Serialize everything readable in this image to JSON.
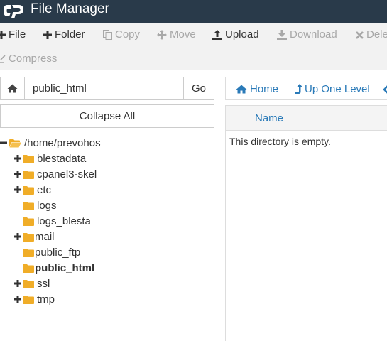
{
  "app": {
    "title": "File Manager",
    "logo_icon": "cpanel-logo"
  },
  "toolbar": {
    "items": [
      {
        "label": "File",
        "icon": "plus-icon",
        "enabled": true
      },
      {
        "label": "Folder",
        "icon": "plus-icon",
        "enabled": true
      },
      {
        "label": "Copy",
        "icon": "copy-icon",
        "enabled": false
      },
      {
        "label": "Move",
        "icon": "move-icon",
        "enabled": false
      },
      {
        "label": "Upload",
        "icon": "upload-icon",
        "enabled": true
      },
      {
        "label": "Download",
        "icon": "download-icon",
        "enabled": false
      },
      {
        "label": "Dele",
        "icon": "close-icon",
        "enabled": false
      },
      {
        "label": "Compress",
        "icon": "compress-icon",
        "enabled": false
      }
    ]
  },
  "path": {
    "value": "public_html",
    "go_label": "Go"
  },
  "collapse_label": "Collapse All",
  "tree": {
    "root": "/home/prevohos",
    "items": [
      {
        "label": "blestadata",
        "expandable": true,
        "bold": false
      },
      {
        "label": "cpanel3-skel",
        "expandable": true,
        "bold": false
      },
      {
        "label": "etc",
        "expandable": true,
        "bold": false
      },
      {
        "label": "logs",
        "expandable": false,
        "bold": false
      },
      {
        "label": "logs_blesta",
        "expandable": false,
        "bold": false
      },
      {
        "label": "mail",
        "expandable": true,
        "bold": false
      },
      {
        "label": "public_ftp",
        "expandable": false,
        "bold": false
      },
      {
        "label": "public_html",
        "expandable": false,
        "bold": true
      },
      {
        "label": "ssl",
        "expandable": true,
        "bold": false
      },
      {
        "label": "tmp",
        "expandable": true,
        "bold": false
      }
    ]
  },
  "nav": {
    "home_label": "Home",
    "up_label": "Up One Level"
  },
  "table": {
    "name_header": "Name",
    "empty_message": "This directory is empty."
  },
  "colors": {
    "topbar": "#293a4a",
    "link": "#2a7ab8",
    "folder": "#f0ad28",
    "toolbar_bg": "#f2f2f2"
  }
}
